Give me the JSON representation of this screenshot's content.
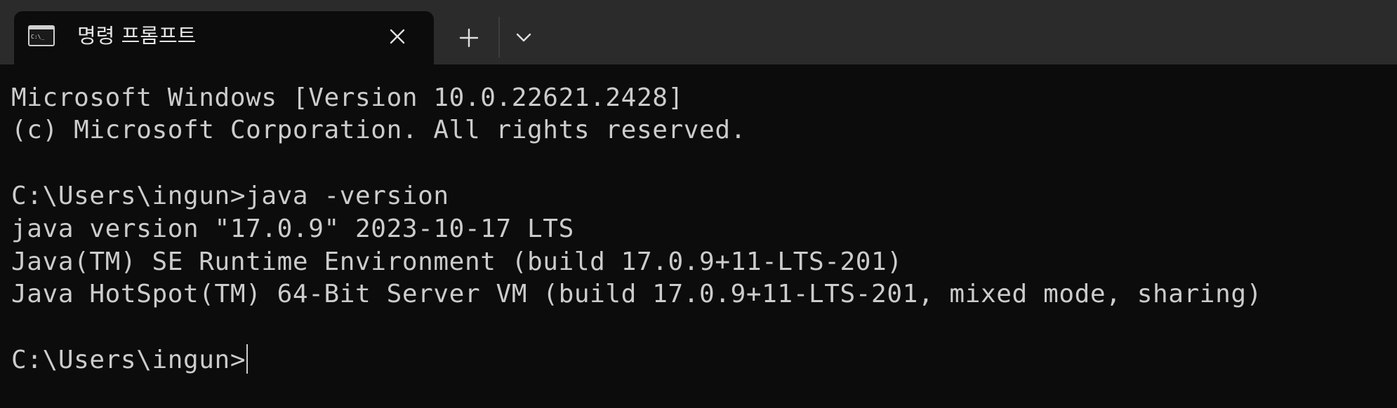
{
  "tab": {
    "title": "명령 프롬프트",
    "icon": "cmd-console-icon",
    "icon_text": "C:\\_"
  },
  "toolbar": {
    "new_tab_icon": "plus-icon",
    "dropdown_icon": "chevron-down-icon"
  },
  "terminal": {
    "lines": [
      "Microsoft Windows [Version 10.0.22621.2428]",
      "(c) Microsoft Corporation. All rights reserved.",
      "",
      "C:\\Users\\ingun>java -version",
      "java version \"17.0.9\" 2023-10-17 LTS",
      "Java(TM) SE Runtime Environment (build 17.0.9+11-LTS-201)",
      "Java HotSpot(TM) 64-Bit Server VM (build 17.0.9+11-LTS-201, mixed mode, sharing)",
      "",
      "C:\\Users\\ingun>"
    ]
  },
  "colors": {
    "background": "#0c0c0c",
    "tabbar": "#2b2b2b",
    "text": "#cccccc"
  }
}
